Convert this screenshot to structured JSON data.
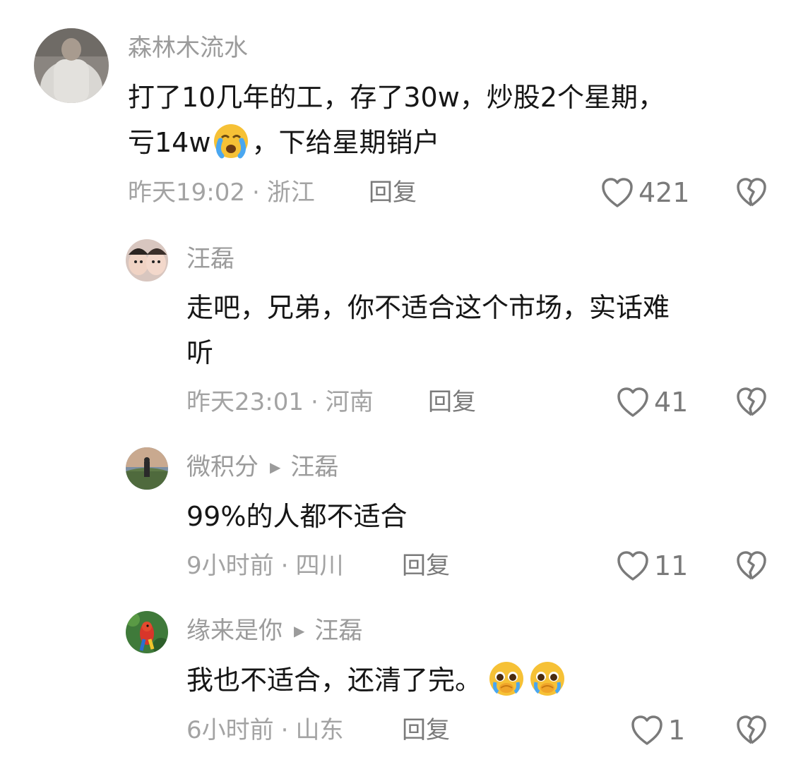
{
  "comments": [
    {
      "author": "森林木流水",
      "text_line1": "打了10几年的工，存了30w，炒股2个星期，",
      "text_line2_before": "亏14w",
      "text_line2_emoji": "crying-face-emoji",
      "text_line2_after": "，下给星期销户",
      "time": "昨天19:02",
      "separator": "·",
      "location": "浙江",
      "reply_label": "回复",
      "likes": "421"
    },
    {
      "author": "汪磊",
      "text_line1": "走吧，兄弟，你不适合这个市场，实话难",
      "text_line2": "听",
      "time": "昨天23:01",
      "separator": "·",
      "location": "河南",
      "reply_label": "回复",
      "likes": "41"
    },
    {
      "author": "微积分",
      "reply_to": "汪磊",
      "text": "99%的人都不适合",
      "time": "9小时前",
      "separator": "·",
      "location": "四川",
      "reply_label": "回复",
      "likes": "11"
    },
    {
      "author": "缘来是你",
      "reply_to": "汪磊",
      "text": "我也不适合，还清了完。",
      "text_emojis": [
        "pleading-face-emoji",
        "pleading-face-emoji"
      ],
      "time": "6小时前",
      "separator": "·",
      "location": "山东",
      "reply_label": "回复",
      "likes": "1"
    }
  ],
  "icons": {
    "like": "heart-outline-icon",
    "dislike": "broken-heart-icon",
    "reply_arrow": "triangle-right-icon"
  },
  "colors": {
    "text_primary": "#161616",
    "text_secondary": "#9b9b9b",
    "icon": "#7a7a7a"
  }
}
